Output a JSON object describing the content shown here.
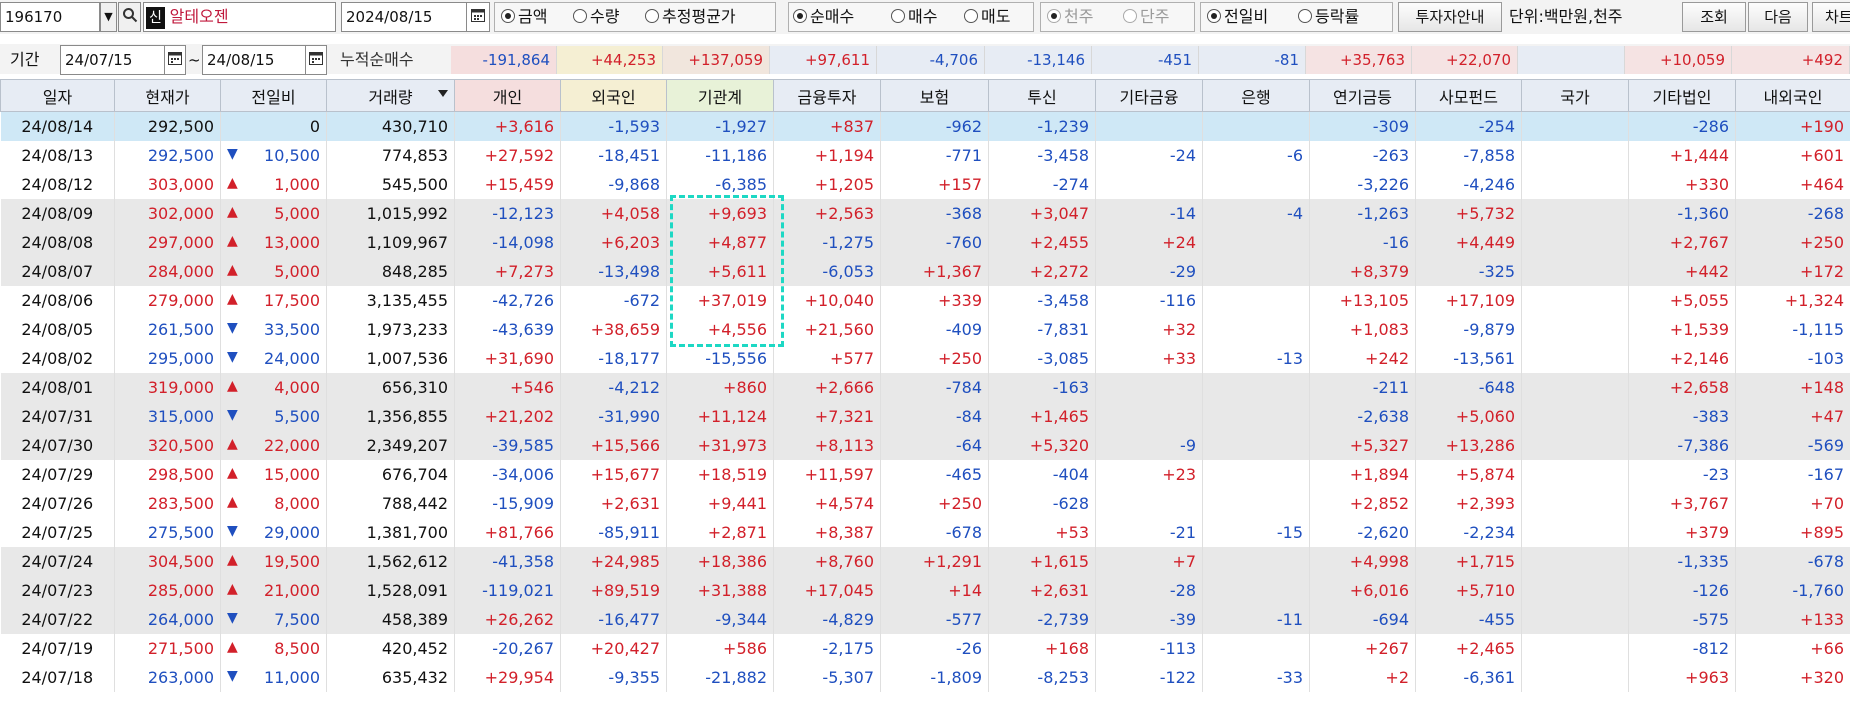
{
  "toolbar": {
    "code": "196170",
    "new_badge": "신",
    "name": "알테오젠",
    "date": "2024/08/15",
    "measure_options": [
      "금액",
      "수량",
      "추정평균가"
    ],
    "trade_options": [
      "순매수",
      "매수",
      "매도"
    ],
    "unit_options": [
      "천주",
      "단주"
    ],
    "compare_options": [
      "전일비",
      "등락률"
    ],
    "guide_button": "투자자안내",
    "unit_text": "단위:백만원,천주",
    "query_button": "조회",
    "next_button": "다음",
    "chart_button": "차트"
  },
  "period": {
    "label": "기간",
    "start": "24/07/15",
    "tilde": "~",
    "end": "24/08/15",
    "cumulative_label": "누적순매수",
    "sums": [
      "-191,864",
      "+44,253",
      "+137,059",
      "+97,611",
      "-4,706",
      "-13,146",
      "-451",
      "-81",
      "+35,763",
      "+22,070",
      "",
      "+10,059",
      "+492"
    ]
  },
  "colors": {
    "positive": "#d2202a",
    "negative": "#1f4fbf",
    "highlight_box": "#1dd8c4"
  },
  "columns": [
    "일자",
    "현재가",
    "전일비",
    "거래량",
    "개인",
    "외국인",
    "기관계",
    "금융투자",
    "보험",
    "투신",
    "기타금융",
    "은행",
    "연기금등",
    "사모펀드",
    "국가",
    "기타법인",
    "내외국인"
  ],
  "rows": [
    {
      "date": "24/08/14",
      "price": "292,500",
      "dir": "",
      "change": "0",
      "volume": "430,710",
      "vals": [
        "+3,616",
        "-1,593",
        "-1,927",
        "+837",
        "-962",
        "-1,239",
        "",
        "",
        "-309",
        "-254",
        "",
        "-286",
        "+190"
      ]
    },
    {
      "date": "24/08/13",
      "price": "292,500",
      "dir": "down",
      "change": "10,500",
      "volume": "774,853",
      "vals": [
        "+27,592",
        "-18,451",
        "-11,186",
        "+1,194",
        "-771",
        "-3,458",
        "-24",
        "-6",
        "-263",
        "-7,858",
        "",
        "+1,444",
        "+601"
      ]
    },
    {
      "date": "24/08/12",
      "price": "303,000",
      "dir": "up",
      "change": "1,000",
      "volume": "545,500",
      "vals": [
        "+15,459",
        "-9,868",
        "-6,385",
        "+1,205",
        "+157",
        "-274",
        "",
        "",
        "-3,226",
        "-4,246",
        "",
        "+330",
        "+464"
      ]
    },
    {
      "date": "24/08/09",
      "price": "302,000",
      "dir": "up",
      "change": "5,000",
      "volume": "1,015,992",
      "vals": [
        "-12,123",
        "+4,058",
        "+9,693",
        "+2,563",
        "-368",
        "+3,047",
        "-14",
        "-4",
        "-1,263",
        "+5,732",
        "",
        "-1,360",
        "-268"
      ]
    },
    {
      "date": "24/08/08",
      "price": "297,000",
      "dir": "up",
      "change": "13,000",
      "volume": "1,109,967",
      "vals": [
        "-14,098",
        "+6,203",
        "+4,877",
        "-1,275",
        "-760",
        "+2,455",
        "+24",
        "",
        "-16",
        "+4,449",
        "",
        "+2,767",
        "+250"
      ]
    },
    {
      "date": "24/08/07",
      "price": "284,000",
      "dir": "up",
      "change": "5,000",
      "volume": "848,285",
      "vals": [
        "+7,273",
        "-13,498",
        "+5,611",
        "-6,053",
        "+1,367",
        "+2,272",
        "-29",
        "",
        "+8,379",
        "-325",
        "",
        "+442",
        "+172"
      ]
    },
    {
      "date": "24/08/06",
      "price": "279,000",
      "dir": "up",
      "change": "17,500",
      "volume": "3,135,455",
      "vals": [
        "-42,726",
        "-672",
        "+37,019",
        "+10,040",
        "+339",
        "-3,458",
        "-116",
        "",
        "+13,105",
        "+17,109",
        "",
        "+5,055",
        "+1,324"
      ]
    },
    {
      "date": "24/08/05",
      "price": "261,500",
      "dir": "down",
      "change": "33,500",
      "volume": "1,973,233",
      "vals": [
        "-43,639",
        "+38,659",
        "+4,556",
        "+21,560",
        "-409",
        "-7,831",
        "+32",
        "",
        "+1,083",
        "-9,879",
        "",
        "+1,539",
        "-1,115"
      ]
    },
    {
      "date": "24/08/02",
      "price": "295,000",
      "dir": "down",
      "change": "24,000",
      "volume": "1,007,536",
      "vals": [
        "+31,690",
        "-18,177",
        "-15,556",
        "+577",
        "+250",
        "-3,085",
        "+33",
        "-13",
        "+242",
        "-13,561",
        "",
        "+2,146",
        "-103"
      ]
    },
    {
      "date": "24/08/01",
      "price": "319,000",
      "dir": "up",
      "change": "4,000",
      "volume": "656,310",
      "vals": [
        "+546",
        "-4,212",
        "+860",
        "+2,666",
        "-784",
        "-163",
        "",
        "",
        "-211",
        "-648",
        "",
        "+2,658",
        "+148"
      ]
    },
    {
      "date": "24/07/31",
      "price": "315,000",
      "dir": "down",
      "change": "5,500",
      "volume": "1,356,855",
      "vals": [
        "+21,202",
        "-31,990",
        "+11,124",
        "+7,321",
        "-84",
        "+1,465",
        "",
        "",
        "-2,638",
        "+5,060",
        "",
        "-383",
        "+47"
      ]
    },
    {
      "date": "24/07/30",
      "price": "320,500",
      "dir": "up",
      "change": "22,000",
      "volume": "2,349,207",
      "vals": [
        "-39,585",
        "+15,566",
        "+31,973",
        "+8,113",
        "-64",
        "+5,320",
        "-9",
        "",
        "+5,327",
        "+13,286",
        "",
        "-7,386",
        "-569"
      ]
    },
    {
      "date": "24/07/29",
      "price": "298,500",
      "dir": "up",
      "change": "15,000",
      "volume": "676,704",
      "vals": [
        "-34,006",
        "+15,677",
        "+18,519",
        "+11,597",
        "-465",
        "-404",
        "+23",
        "",
        "+1,894",
        "+5,874",
        "",
        "-23",
        "-167"
      ]
    },
    {
      "date": "24/07/26",
      "price": "283,500",
      "dir": "up",
      "change": "8,000",
      "volume": "788,442",
      "vals": [
        "-15,909",
        "+2,631",
        "+9,441",
        "+4,574",
        "+250",
        "-628",
        "",
        "",
        "+2,852",
        "+2,393",
        "",
        "+3,767",
        "+70"
      ]
    },
    {
      "date": "24/07/25",
      "price": "275,500",
      "dir": "down",
      "change": "29,000",
      "volume": "1,381,700",
      "vals": [
        "+81,766",
        "-85,911",
        "+2,871",
        "+8,387",
        "-678",
        "+53",
        "-21",
        "-15",
        "-2,620",
        "-2,234",
        "",
        "+379",
        "+895"
      ]
    },
    {
      "date": "24/07/24",
      "price": "304,500",
      "dir": "up",
      "change": "19,500",
      "volume": "1,562,612",
      "vals": [
        "-41,358",
        "+24,985",
        "+18,386",
        "+8,760",
        "+1,291",
        "+1,615",
        "+7",
        "",
        "+4,998",
        "+1,715",
        "",
        "-1,335",
        "-678"
      ]
    },
    {
      "date": "24/07/23",
      "price": "285,000",
      "dir": "up",
      "change": "21,000",
      "volume": "1,528,091",
      "vals": [
        "-119,021",
        "+89,519",
        "+31,388",
        "+17,045",
        "+14",
        "+2,631",
        "-28",
        "",
        "+6,016",
        "+5,710",
        "",
        "-126",
        "-1,760"
      ]
    },
    {
      "date": "24/07/22",
      "price": "264,000",
      "dir": "down",
      "change": "7,500",
      "volume": "458,389",
      "vals": [
        "+26,262",
        "-16,477",
        "-9,344",
        "-4,829",
        "-577",
        "-2,739",
        "-39",
        "-11",
        "-694",
        "-455",
        "",
        "-575",
        "+133"
      ]
    },
    {
      "date": "24/07/19",
      "price": "271,500",
      "dir": "up",
      "change": "8,500",
      "volume": "420,452",
      "vals": [
        "-20,267",
        "+20,427",
        "+586",
        "-2,175",
        "-26",
        "+168",
        "-113",
        "",
        "+267",
        "+2,465",
        "",
        "-812",
        "+66"
      ]
    },
    {
      "date": "24/07/18",
      "price": "263,000",
      "dir": "down",
      "change": "11,000",
      "volume": "635,432",
      "vals": [
        "+29,954",
        "-9,355",
        "-21,882",
        "-5,307",
        "-1,809",
        "-8,253",
        "-122",
        "-33",
        "+2",
        "-6,361",
        "",
        "+963",
        "+320"
      ]
    }
  ]
}
